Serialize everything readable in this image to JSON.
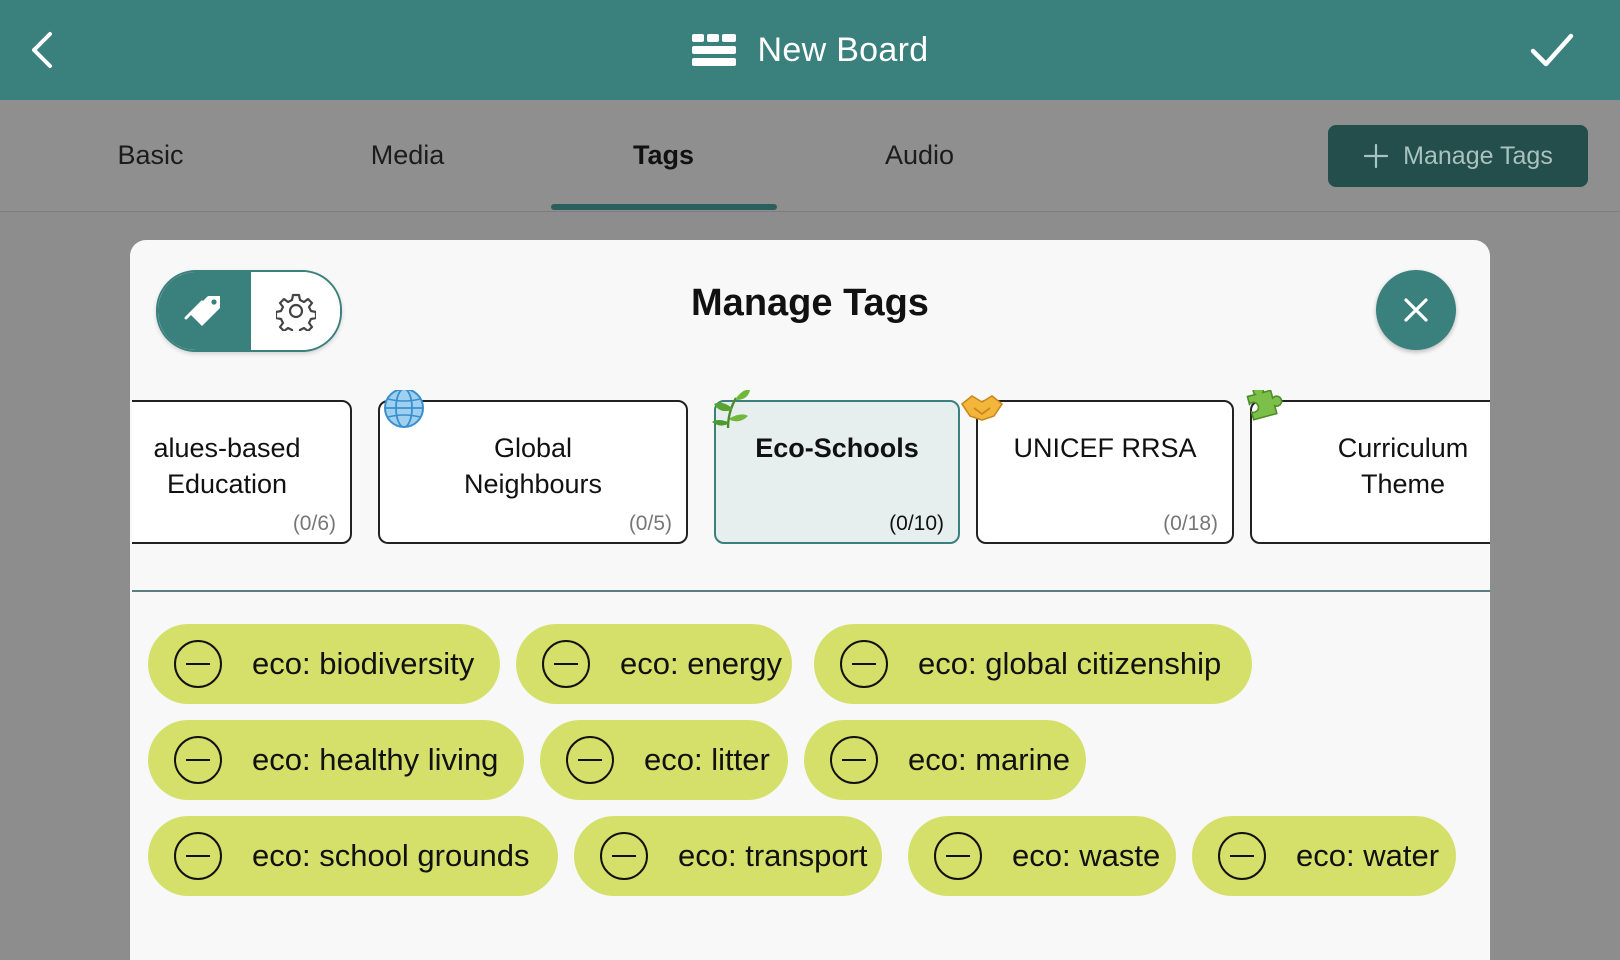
{
  "header": {
    "title": "New Board",
    "back_icon": "chevron-left-icon",
    "confirm_icon": "checkmark-icon",
    "board_icon": "board-grid-icon",
    "bg_color": "#3a807c"
  },
  "tabs": [
    {
      "label": "Basic",
      "active": false
    },
    {
      "label": "Media",
      "active": false
    },
    {
      "label": "Tags",
      "active": true
    },
    {
      "label": "Audio",
      "active": false
    }
  ],
  "manage_tags_button": {
    "label": "Manage Tags",
    "icon": "plus-icon"
  },
  "modal": {
    "title": "Manage Tags",
    "toggle": {
      "left_icon": "tags-icon",
      "right_icon": "gear-icon",
      "selected": "left"
    },
    "close_icon": "close-icon"
  },
  "tag_groups": [
    {
      "name_line1": "alues-based",
      "name_line2": "Education",
      "count": "(0/6)",
      "icon": "",
      "selected": false
    },
    {
      "name_line1": "Global",
      "name_line2": "Neighbours",
      "count": "(0/5)",
      "icon": "globe-icon",
      "selected": false
    },
    {
      "name_line1": "Eco-Schools",
      "name_line2": "",
      "count": "(0/10)",
      "icon": "leaf-icon",
      "selected": true
    },
    {
      "name_line1": "UNICEF RRSA",
      "name_line2": "",
      "count": "(0/18)",
      "icon": "handshake-icon",
      "selected": false
    },
    {
      "name_line1": "Curriculum",
      "name_line2": "Theme",
      "count": "",
      "icon": "puzzle-icon",
      "selected": false
    }
  ],
  "tags": [
    "eco: biodiversity",
    "eco: energy",
    "eco: global citizenship",
    "eco: healthy living",
    "eco: litter",
    "eco: marine",
    "eco: school grounds",
    "eco: transport",
    "eco: waste",
    "eco: water"
  ],
  "colors": {
    "accent": "#3a807c",
    "chip": "#d5e06b",
    "dark_button": "#234e4c"
  }
}
